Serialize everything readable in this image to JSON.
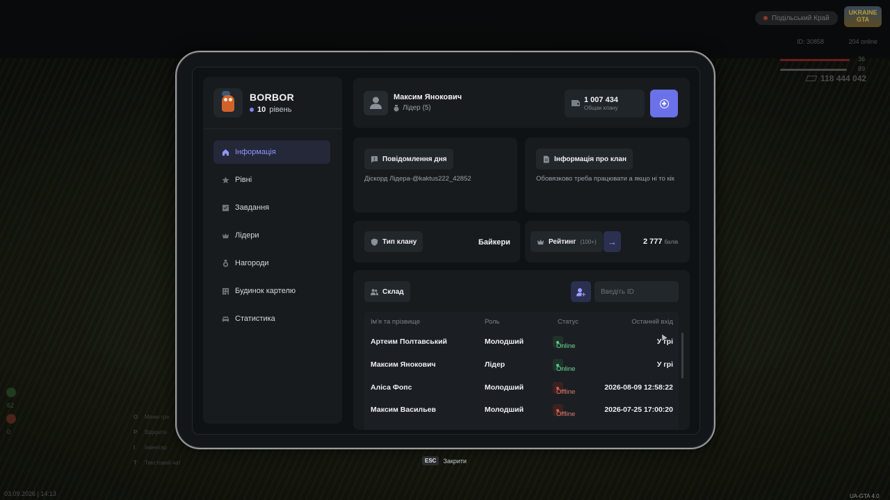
{
  "game": {
    "region": "Подільський Край",
    "logo_top": "UKRAINE",
    "logo_bottom": "GTA",
    "stat_left": "ID: 30858",
    "stat_right": "204 online",
    "hp_value": "36",
    "armor_value": "89",
    "money": "118 444 042",
    "date": "03.09.2026 | 14:13",
    "version": "UA-GTA 4.0",
    "side_num_1": "62",
    "side_num_2": "0",
    "keys": [
      {
        "key": "O",
        "label": "Меню гри"
      },
      {
        "key": "P",
        "label": "Відкрити"
      },
      {
        "key": "I",
        "label": "Інвентар"
      },
      {
        "key": "T",
        "label": "Текстовий чат"
      }
    ]
  },
  "clan": {
    "name": "BORBOR",
    "level_value": "10",
    "level_unit": "рівень"
  },
  "nav": [
    {
      "label": "Інформація",
      "icon": "home-icon",
      "active": true
    },
    {
      "label": "Рівні",
      "icon": "star-icon"
    },
    {
      "label": "Завдання",
      "icon": "task-icon"
    },
    {
      "label": "Лідери",
      "icon": "crown-icon"
    },
    {
      "label": "Нагороди",
      "icon": "medal-icon"
    },
    {
      "label": "Будинок картелю",
      "icon": "building-icon"
    },
    {
      "label": "Статистика",
      "icon": "car-icon"
    }
  ],
  "user": {
    "name": "Максим Янокович",
    "role": "Лідер (5)"
  },
  "balance": {
    "value": "1 007 434",
    "caption": "Общак клану"
  },
  "motd": {
    "title": "Повідомлення дня",
    "text": "Діскорд  Лідера-@kaktus222_42852"
  },
  "clan_info": {
    "title": "Інформація про клан",
    "text": "Обовязково треба працювати а якщо ні то кік"
  },
  "clan_type": {
    "label": "Тип клану",
    "value": "Байкери"
  },
  "rating": {
    "label": "Рейтинг",
    "sub": "(100+)",
    "value": "2 777",
    "unit": "балів"
  },
  "members": {
    "title": "Склад",
    "id_placeholder": "Введіть ID",
    "columns": [
      "Ім'я та прізвище",
      "Роль",
      "Статус",
      "Останній вхід"
    ],
    "rows": [
      {
        "name": "Артеим Полтавський",
        "role": "Молодший",
        "status": "Online",
        "last": "У грі"
      },
      {
        "name": "Максим Янокович",
        "role": "Лідер",
        "status": "Online",
        "last": "У грі"
      },
      {
        "name": "Аліса Фопс",
        "role": "Молодший",
        "status": "Offline",
        "last": "2026-08-09 12:58:22"
      },
      {
        "name": "Максим Васильев",
        "role": "Молодший",
        "status": "Offline",
        "last": "2026-07-25 17:00:20"
      }
    ]
  },
  "footer": {
    "esc_key": "ESC",
    "esc_label": "Закрити"
  },
  "colors": {
    "accent": "#6b71e8",
    "online": "#4fd08a",
    "offline": "#e2574a"
  }
}
